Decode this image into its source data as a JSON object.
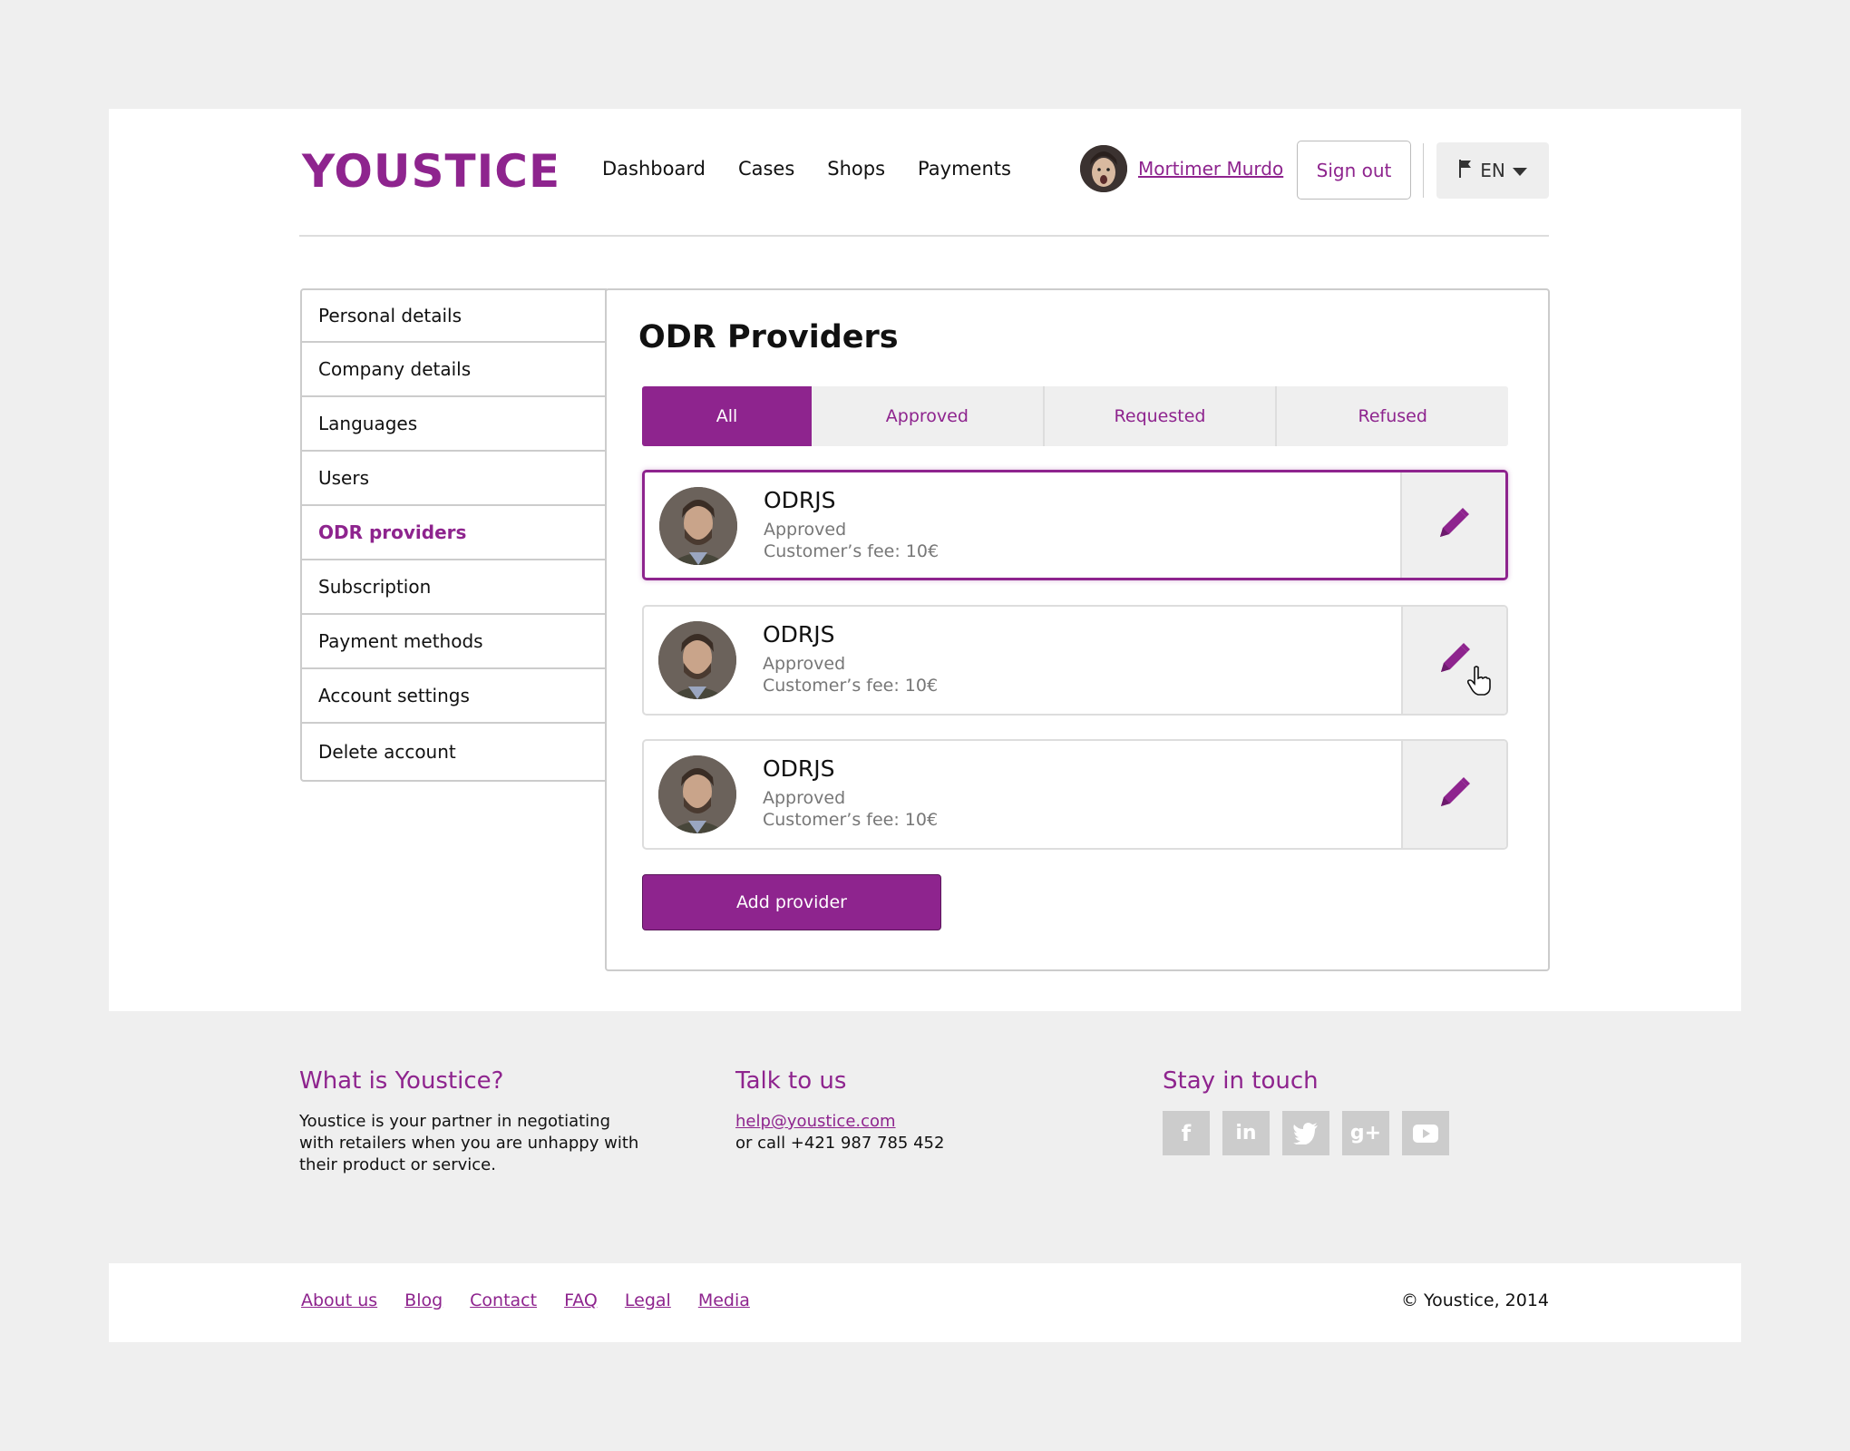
{
  "brand": {
    "name": "YOUSTICE",
    "color": "#8e248e"
  },
  "nav": [
    "Dashboard",
    "Cases",
    "Shops",
    "Payments"
  ],
  "user": {
    "name": "Mortimer Murdo",
    "signout_label": "Sign out",
    "language": "EN"
  },
  "sidebar": {
    "items": [
      {
        "label": "Personal details"
      },
      {
        "label": "Company details"
      },
      {
        "label": "Languages"
      },
      {
        "label": "Users"
      },
      {
        "label": "ODR providers"
      },
      {
        "label": "Subscription"
      },
      {
        "label": "Payment methods"
      },
      {
        "label": "Account settings"
      },
      {
        "label": "Delete account"
      }
    ],
    "active_index": 4
  },
  "main": {
    "title": "ODR Providers",
    "tabs": [
      "All",
      "Approved",
      "Requested",
      "Refused"
    ],
    "providers": [
      {
        "name": "ODRJS",
        "status": "Approved",
        "fee": "Customer’s fee: 10€"
      },
      {
        "name": "ODRJS",
        "status": "Approved",
        "fee": "Customer’s fee: 10€"
      },
      {
        "name": "ODRJS",
        "status": "Approved",
        "fee": "Customer’s fee: 10€"
      }
    ],
    "add_label": "Add provider"
  },
  "footer": {
    "about": {
      "title": "What is Youstice?",
      "text": "Youstice is your partner in negotiating with retailers when you are unhappy with their product or service."
    },
    "contact": {
      "title": "Talk to us",
      "email": "help@youstice.com",
      "phone": "or call +421 987 785 452"
    },
    "social": {
      "title": "Stay in touch",
      "icons": [
        "facebook-icon",
        "linkedin-icon",
        "twitter-icon",
        "google-plus-icon",
        "youtube-icon"
      ]
    },
    "links": [
      "About us",
      "Blog",
      "Contact",
      "FAQ",
      "Legal",
      "Media"
    ],
    "copyright": "© Youstice, 2014"
  }
}
